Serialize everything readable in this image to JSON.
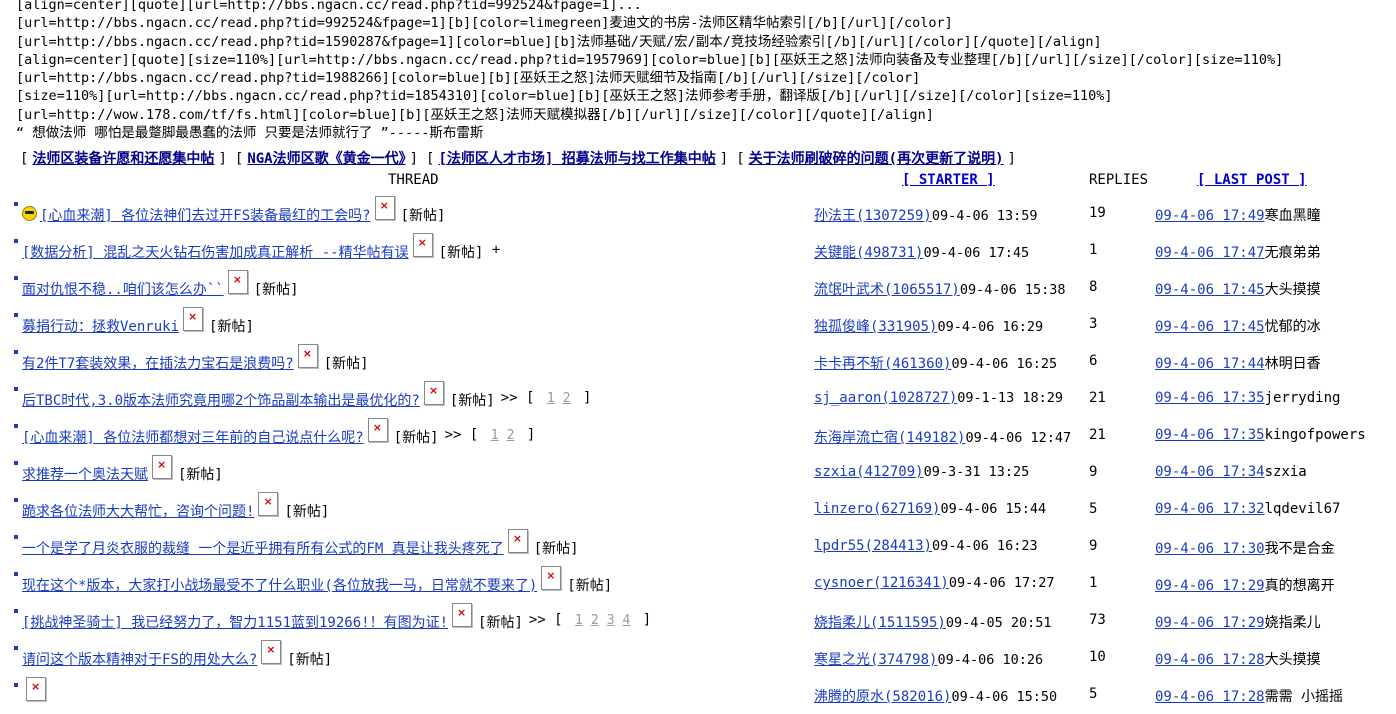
{
  "header_lines": [
    "[align=center][quote][url=http://bbs.ngacn.cc/read.php?tid=992524&fpage=1]...",
    "[url=http://bbs.ngacn.cc/read.php?tid=992524&fpage=1][b][color=limegreen]麦迪文的书房-法师区精华帖索引[/b][/url][/color]",
    "[url=http://bbs.ngacn.cc/read.php?tid=1590287&fpage=1][color=blue][b]法师基础/天赋/宏/副本/竞技场经验索引[/b][/url][/color][/quote][/align]",
    "[align=center][quote][size=110%][url=http://bbs.ngacn.cc/read.php?tid=1957969][color=blue][b][巫妖王之怒]法师向装备及专业整理[/b][/url][/size][/color][size=110%]",
    "[url=http://bbs.ngacn.cc/read.php?tid=1988266][color=blue][b][巫妖王之怒]法师天赋细节及指南[/b][/url][/size][/color]",
    "[size=110%][url=http://bbs.ngacn.cc/read.php?tid=1854310][color=blue][b][巫妖王之怒]法师参考手册，翻译版[/b][/url][/size][/color][size=110%]",
    "[url=http://wow.178.com/tf/fs.html][color=blue][b][巫妖王之怒]法师天赋模拟器[/b][/url][/size][/color][/quote][/align]",
    "“ 想做法师 哪怕是最蹩脚最愚蠢的法师 只要是法师就行了 ”-----斯布雷斯"
  ],
  "top_nav": [
    "法师区装备许愿和还愿集中帖",
    "NGA法师区歌《黄金一代》",
    "[法师区人才市场] 招募法师与找工作集中帖",
    "关于法师刷破碎的问题(再次更新了说明)"
  ],
  "columns": {
    "thread": "THREAD",
    "starter": "[ STARTER ]",
    "replies": "REPLIES",
    "last_post": "[ LAST POST ]"
  },
  "new_tag": "[新帖]",
  "threads": [
    {
      "title": "[心血来潮] 各位法神们去过开FS装备最红的工会吗?",
      "icon": "smiley-icon",
      "suffix": "",
      "pages": [],
      "starter": "孙法王(1307259)",
      "start_date": "09-4-06 13:59",
      "replies": "19",
      "last_time": "09-4-06 17:49",
      "last_user": "寒血黑瞳"
    },
    {
      "title": "[数据分析] 混乱之天火钻石伤害加成真正解析 --精华帖有误",
      "icon": "",
      "suffix": "+",
      "pages": [],
      "starter": "关键能(498731)",
      "start_date": "09-4-06 17:45",
      "replies": "1",
      "last_time": "09-4-06 17:47",
      "last_user": "无痕弟弟"
    },
    {
      "title": "面对仇恨不稳..咱们该怎么办``",
      "icon": "",
      "suffix": "",
      "pages": [],
      "starter": "流氓叶武术(1065517)",
      "start_date": "09-4-06 15:38",
      "replies": "8",
      "last_time": "09-4-06 17:45",
      "last_user": "大头摸摸"
    },
    {
      "title": "募捐行动：拯救Venruki",
      "icon": "",
      "suffix": "",
      "pages": [],
      "starter": "独孤俊峰(331905)",
      "start_date": "09-4-06 16:29",
      "replies": "3",
      "last_time": "09-4-06 17:45",
      "last_user": "忧郁的冰"
    },
    {
      "title": "有2件T7套装效果，在插法力宝石是浪费吗?",
      "icon": "",
      "suffix": "",
      "pages": [],
      "starter": "卡卡再不斩(461360)",
      "start_date": "09-4-06 16:25",
      "replies": "6",
      "last_time": "09-4-06 17:44",
      "last_user": "林明日香"
    },
    {
      "title": "后TBC时代,3.0版本法师究竟用哪2个饰品副本输出是最优化的?",
      "icon": "",
      "suffix": "",
      "pages": [
        "1",
        "2"
      ],
      "starter": "sj_aaron(1028727)",
      "start_date": "09-1-13 18:29",
      "replies": "21",
      "last_time": "09-4-06 17:35",
      "last_user": "jerryding"
    },
    {
      "title": "[心血来潮] 各位法师都想对三年前的自己说点什么呢?",
      "icon": "",
      "suffix": "",
      "pages": [
        "1",
        "2"
      ],
      "starter": "东海岸流亡宿(149182)",
      "start_date": "09-4-06 12:47",
      "replies": "21",
      "last_time": "09-4-06 17:35",
      "last_user": "kingofpowers"
    },
    {
      "title": "求推荐一个奥法天赋",
      "icon": "",
      "suffix": "",
      "pages": [],
      "starter": "szxia(412709)",
      "start_date": "09-3-31 13:25",
      "replies": "9",
      "last_time": "09-4-06 17:34",
      "last_user": "szxia"
    },
    {
      "title": "跪求各位法师大大帮忙，咨询个问题!",
      "icon": "",
      "suffix": "",
      "pages": [],
      "starter": "linzero(627169)",
      "start_date": "09-4-06 15:44",
      "replies": "5",
      "last_time": "09-4-06 17:32",
      "last_user": "lqdevil67"
    },
    {
      "title": "一个是学了月炎衣服的裁缝 一个是近乎拥有所有公式的FM 真是让我头疼死了",
      "icon": "",
      "suffix": "",
      "pages": [],
      "starter": "lpdr55(284413)",
      "start_date": "09-4-06 16:23",
      "replies": "9",
      "last_time": "09-4-06 17:30",
      "last_user": "我不是合金"
    },
    {
      "title": "现在这个*版本，大家打小战场最受不了什么职业(各位放我一马，日常就不要来了)",
      "icon": "",
      "suffix": "",
      "pages": [],
      "starter": "cysnoer(1216341)",
      "start_date": "09-4-06 17:27",
      "replies": "1",
      "last_time": "09-4-06 17:29",
      "last_user": "真的想离开"
    },
    {
      "title": "[挑战神圣骑士] 我已经努力了，智力1151蓝到19266!！有图为证!",
      "icon": "",
      "suffix": "",
      "pages": [
        "1",
        "2",
        "3",
        "4"
      ],
      "starter": "娆指柔儿(1511595)",
      "start_date": "09-4-05 20:51",
      "replies": "73",
      "last_time": "09-4-06 17:29",
      "last_user": "娆指柔儿"
    },
    {
      "title": "请问这个版本精神对于FS的用处大么?",
      "icon": "",
      "suffix": "",
      "pages": [],
      "starter": "寒星之光(374798)",
      "start_date": "09-4-06 10:26",
      "replies": "10",
      "last_time": "09-4-06 17:28",
      "last_user": "大头摸摸"
    },
    {
      "title": "",
      "icon": "",
      "suffix": "",
      "pages": [],
      "starter": "沸腾的原水(582016)",
      "start_date": "09-4-06 15:50",
      "replies": "5",
      "last_time": "09-4-06 17:28",
      "last_user": "需需 小摇摇"
    }
  ]
}
